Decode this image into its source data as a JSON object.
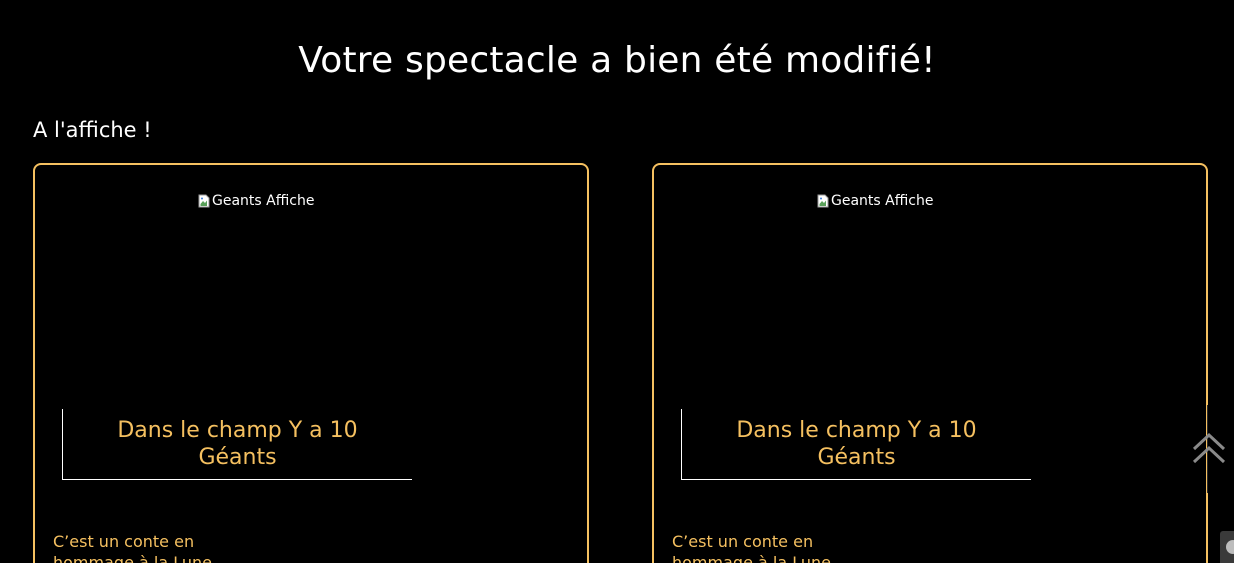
{
  "header": {
    "title": "Votre spectacle a bien été modifié!"
  },
  "section": {
    "heading": "A l'affiche !"
  },
  "cards": [
    {
      "image_alt": "Geants Affiche",
      "title": "Dans le champ Y a 10 Géants",
      "description": "C’est un conte en hommage à la Lune"
    },
    {
      "image_alt": "Geants Affiche",
      "title": "Dans le champ Y a 10 Géants",
      "description": "C’est un conte en hommage à la Lune"
    }
  ],
  "colors": {
    "background": "#000000",
    "accent": "#f5c060",
    "text": "#ffffff"
  },
  "icons": {
    "scroll_top": "double-chevron-up-icon",
    "broken_image": "broken-image-icon",
    "corner_widget": "accessibility-icon"
  }
}
